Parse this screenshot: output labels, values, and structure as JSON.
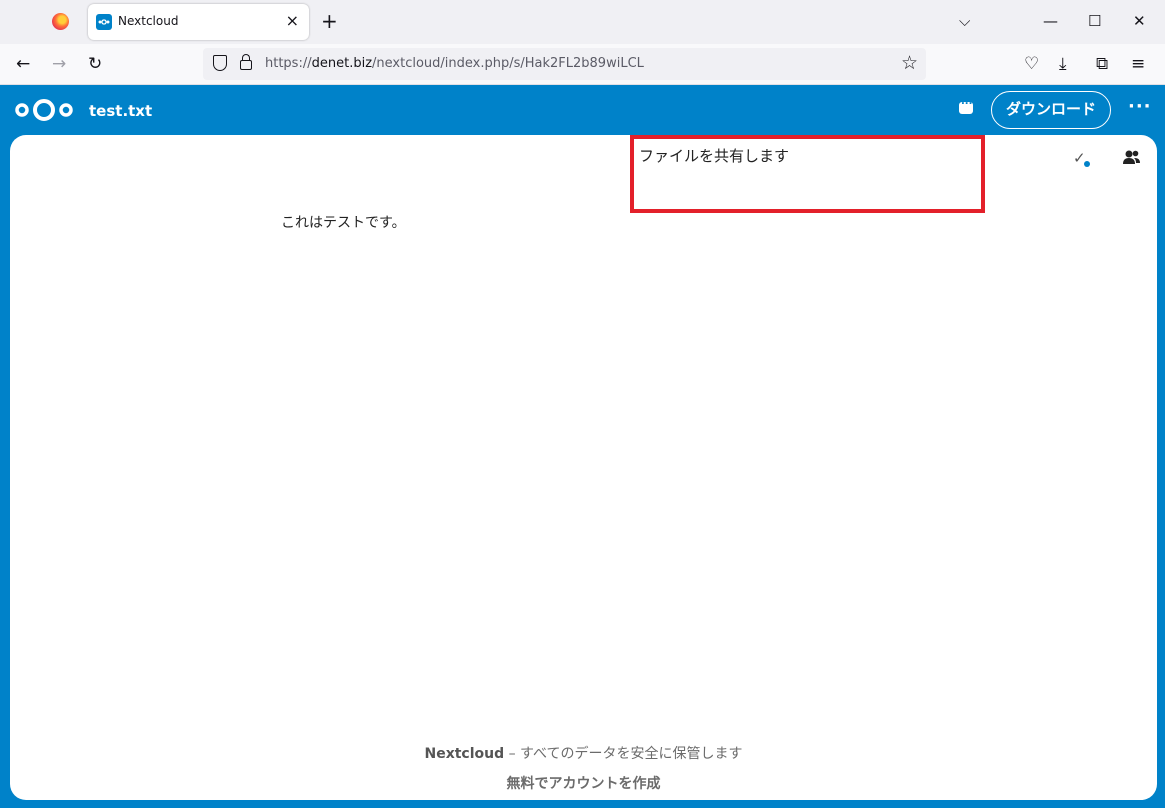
{
  "browser": {
    "tab_title": "Nextcloud",
    "tab_close": "×",
    "new_tab": "+",
    "list_all_tabs": "⌵",
    "minimize": "—",
    "maximize": "☐",
    "close": "✕",
    "back": "←",
    "forward": "→",
    "reload": "↻",
    "url_prefix": "https://",
    "url_domain": "denet.biz",
    "url_path": "/nextcloud/index.php/s/Hak2FL2b89wiLCL",
    "bookmark_star": "☆",
    "pocket": "♡",
    "downloads": "⤓",
    "extensions": "⧉",
    "menu": "≡"
  },
  "nextcloud": {
    "file_name": "test.txt",
    "download_label": "ダウンロード",
    "more_label": "···",
    "file_content": "これはテストです。",
    "share_label": "ファイルを共有します",
    "sync_check": "✓",
    "footer_brand": "Nextcloud",
    "footer_tagline": " – すべてのデータを安全に保管します",
    "footer_signup": "無料でアカウントを作成",
    "colors": {
      "brand": "#0082c9",
      "highlight_border": "#e3202a"
    }
  }
}
